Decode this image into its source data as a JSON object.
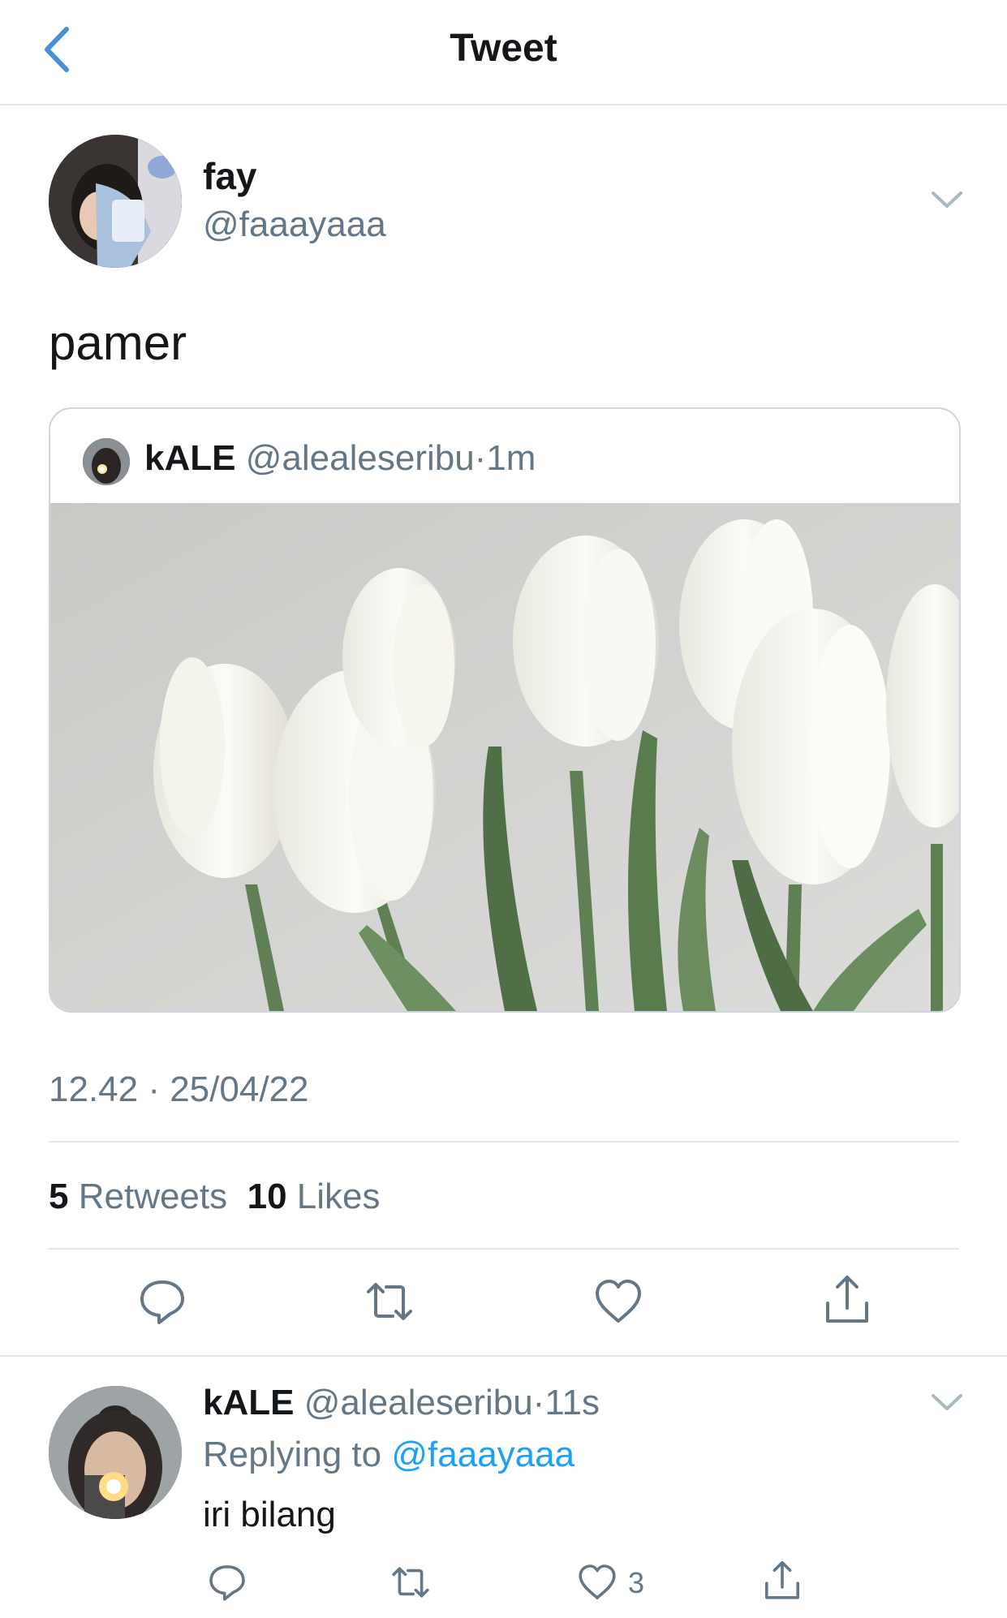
{
  "header": {
    "title": "Tweet"
  },
  "tweet": {
    "author_name": "fay",
    "author_handle": "@faaayaaa",
    "text": "pamer",
    "quoted": {
      "name": "kALE",
      "handle": "@alealeseribu",
      "separator": "·",
      "time": "1m"
    },
    "timestamp": "12.42 · 25/04/22",
    "retweets_count": "5",
    "retweets_label": "Retweets",
    "likes_count": "10",
    "likes_label": "Likes"
  },
  "reply": {
    "name": "kALE",
    "handle": "@alealeseribu",
    "separator": "·",
    "time": "11s",
    "replying_prefix": "Replying to",
    "replying_to": "@faaayaaa",
    "text": "iri bilang",
    "like_count": "3"
  },
  "colors": {
    "accent": "#1da1f2",
    "back_arrow": "#4a90d9",
    "secondary_text": "#657786",
    "divider": "#e1e8ed"
  },
  "icons": [
    "back-arrow-icon",
    "chevron-down-icon",
    "reply-icon",
    "retweet-icon",
    "like-icon",
    "share-icon"
  ]
}
